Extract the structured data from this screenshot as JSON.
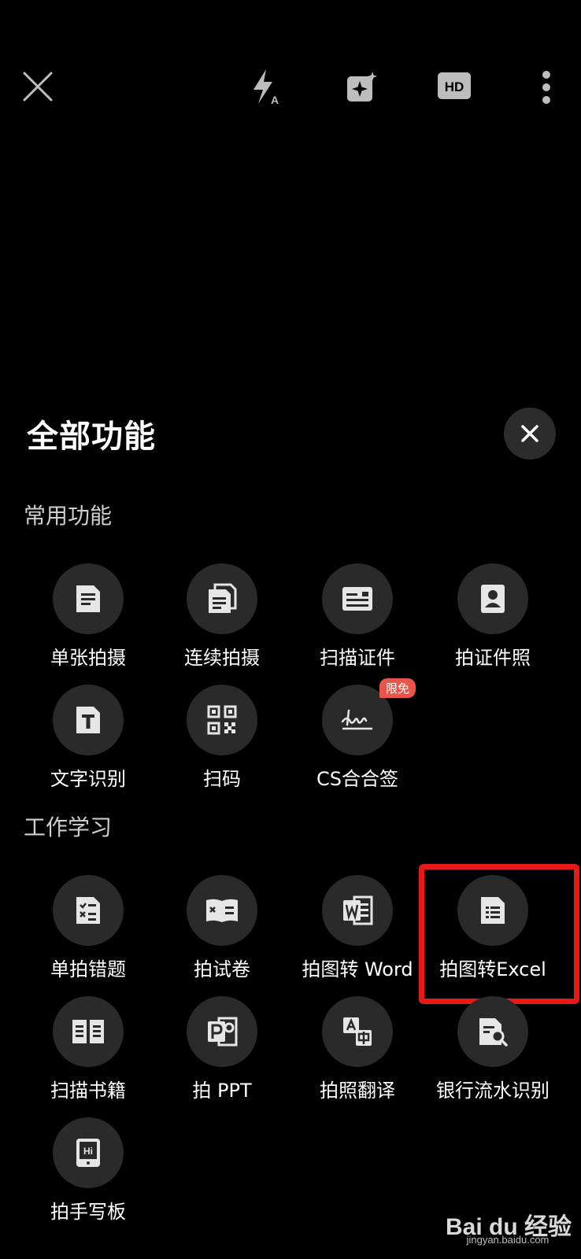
{
  "toolbar": {
    "icons": [
      "close-icon",
      "flash-auto-icon",
      "ai-enhance-icon",
      "hd-icon",
      "more-vertical-icon"
    ],
    "hd_label": "HD",
    "flash_sub": "A"
  },
  "panel": {
    "title": "全部功能",
    "sections": [
      {
        "title": "常用功能",
        "items": [
          {
            "label": "单张拍摄",
            "icon": "single-page-icon"
          },
          {
            "label": "连续拍摄",
            "icon": "multi-page-icon"
          },
          {
            "label": "扫描证件",
            "icon": "id-card-icon"
          },
          {
            "label": "拍证件照",
            "icon": "portrait-photo-icon"
          },
          {
            "label": "文字识别",
            "icon": "text-recognition-icon"
          },
          {
            "label": "扫码",
            "icon": "qr-code-icon"
          },
          {
            "label": "CS合合签",
            "icon": "signature-icon",
            "badge": "限免"
          }
        ]
      },
      {
        "title": "工作学习",
        "items": [
          {
            "label": "单拍错题",
            "icon": "wrong-question-icon"
          },
          {
            "label": "拍试卷",
            "icon": "exam-paper-icon"
          },
          {
            "label": "拍图转 Word",
            "icon": "word-icon"
          },
          {
            "label": "拍图转Excel",
            "icon": "excel-icon"
          },
          {
            "label": "扫描书籍",
            "icon": "book-icon"
          },
          {
            "label": "拍 PPT",
            "icon": "ppt-icon"
          },
          {
            "label": "拍照翻译",
            "icon": "translate-icon"
          },
          {
            "label": "银行流水识别",
            "icon": "bank-statement-icon"
          },
          {
            "label": "拍手写板",
            "icon": "handwriting-board-icon"
          }
        ]
      }
    ]
  },
  "watermark": {
    "logo": "Bai du 经验",
    "sub": "jingyan.baidu.com"
  },
  "colors": {
    "background": "#000000",
    "circle": "#2a2a2a",
    "highlight": "#e81916",
    "badge": "#e8564b"
  }
}
